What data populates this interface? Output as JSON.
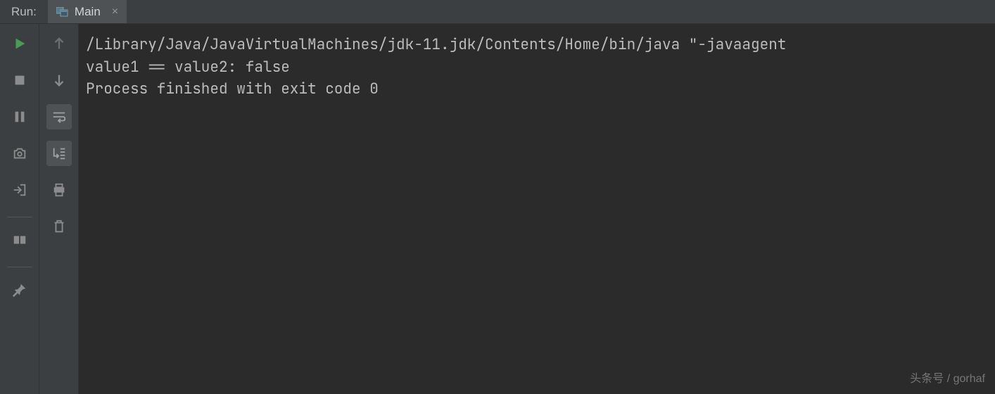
{
  "header": {
    "run_label": "Run:",
    "tab_label": "Main",
    "tab_close": "×"
  },
  "console": {
    "line1": "/Library/Java/JavaVirtualMachines/jdk-11.jdk/Contents/Home/bin/java \"-javaagent",
    "line2": "value1 == value2: false",
    "line3": "",
    "line4": "Process finished with exit code 0"
  },
  "watermark": "头条号 / gorhaf",
  "icons": {
    "run": "play",
    "stop": "stop",
    "pause": "pause",
    "dump": "camera",
    "exit": "exit",
    "layout": "layout",
    "pin": "pin",
    "up": "arrow-up",
    "down": "arrow-down",
    "wrap": "soft-wrap",
    "scroll": "scroll-to-end",
    "print": "print",
    "clear": "trash"
  }
}
